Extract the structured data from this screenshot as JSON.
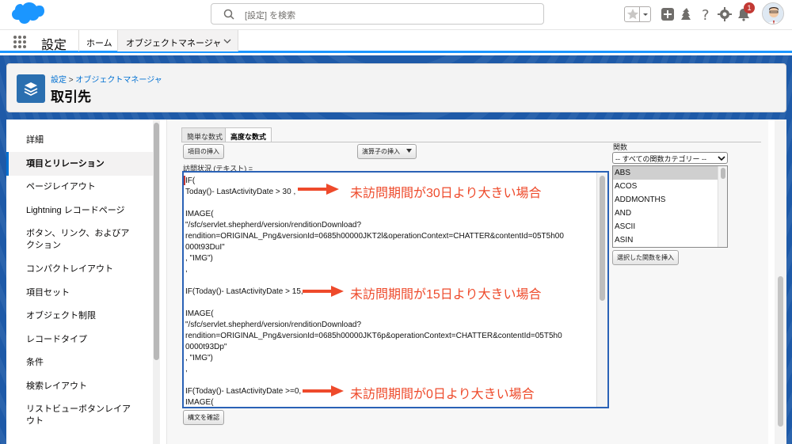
{
  "header": {
    "search_placeholder": "[設定] を検索",
    "notification_count": "1"
  },
  "nav": {
    "app_name": "設定",
    "home_label": "ホーム",
    "tab_label": "オブジェクトマネージャ"
  },
  "page_header": {
    "breadcrumb_setup": "設定",
    "breadcrumb_sep": " > ",
    "breadcrumb_om": "オブジェクトマネージャ",
    "title": "取引先"
  },
  "sidebar": {
    "items": [
      {
        "label": "詳細"
      },
      {
        "label": "項目とリレーション"
      },
      {
        "label": "ページレイアウト"
      },
      {
        "label": "Lightning レコードページ"
      },
      {
        "label": "ボタン、リンク、およびアクション"
      },
      {
        "label": "コンパクトレイアウト"
      },
      {
        "label": "項目セット"
      },
      {
        "label": "オブジェクト制限"
      },
      {
        "label": "レコードタイプ"
      },
      {
        "label": "条件"
      },
      {
        "label": "検索レイアウト"
      },
      {
        "label": "リストビューボタンレイアウト"
      }
    ]
  },
  "formula": {
    "tab_simple": "簡単な数式",
    "tab_advanced": "高度な数式",
    "insert_field": "項目の挿入",
    "insert_operator": "演算子の挿入",
    "field_label": "訪問状況 (テキスト) =",
    "code_lines": [
      "IF(",
      "Today()- LastActivityDate > 30 ,",
      "",
      "IMAGE(",
      "\"/sfc/servlet.shepherd/version/renditionDownload?",
      "rendition=ORIGINAL_Png&versionId=0685h00000JKT2l&operationContext=CHATTER&contentId=05T5h00",
      "000t93DuI\"",
      ", \"IMG\")",
      ",",
      "",
      "IF(Today()- LastActivityDate > 15,",
      "",
      "IMAGE(",
      "\"/sfc/servlet.shepherd/version/renditionDownload?",
      "rendition=ORIGINAL_Png&versionId=0685h00000JKT6p&operationContext=CHATTER&contentId=05T5h0",
      "0000t93Dp\"",
      ", \"IMG\")",
      ",",
      "",
      "IF(Today()- LastActivityDate >=0,",
      "IMAGE("
    ],
    "check_syntax": "構文を確認",
    "functions_label": "関数",
    "function_category": "-- すべての関数カテゴリー --",
    "functions": [
      "ABS",
      "ACOS",
      "ADDMONTHS",
      "AND",
      "ASCII",
      "ASIN"
    ],
    "insert_function": "選択した関数を挿入"
  },
  "annotations": [
    "未訪問期間が30日より大きい場合",
    "未訪問期間が15日より大きい場合",
    "未訪問期間が0日より大きい場合"
  ],
  "colors": {
    "brand_blue": "#1b96ff",
    "band_blue": "#1e5aa8",
    "annotation_red": "#ee4a2b",
    "link_blue": "#0070d2"
  }
}
